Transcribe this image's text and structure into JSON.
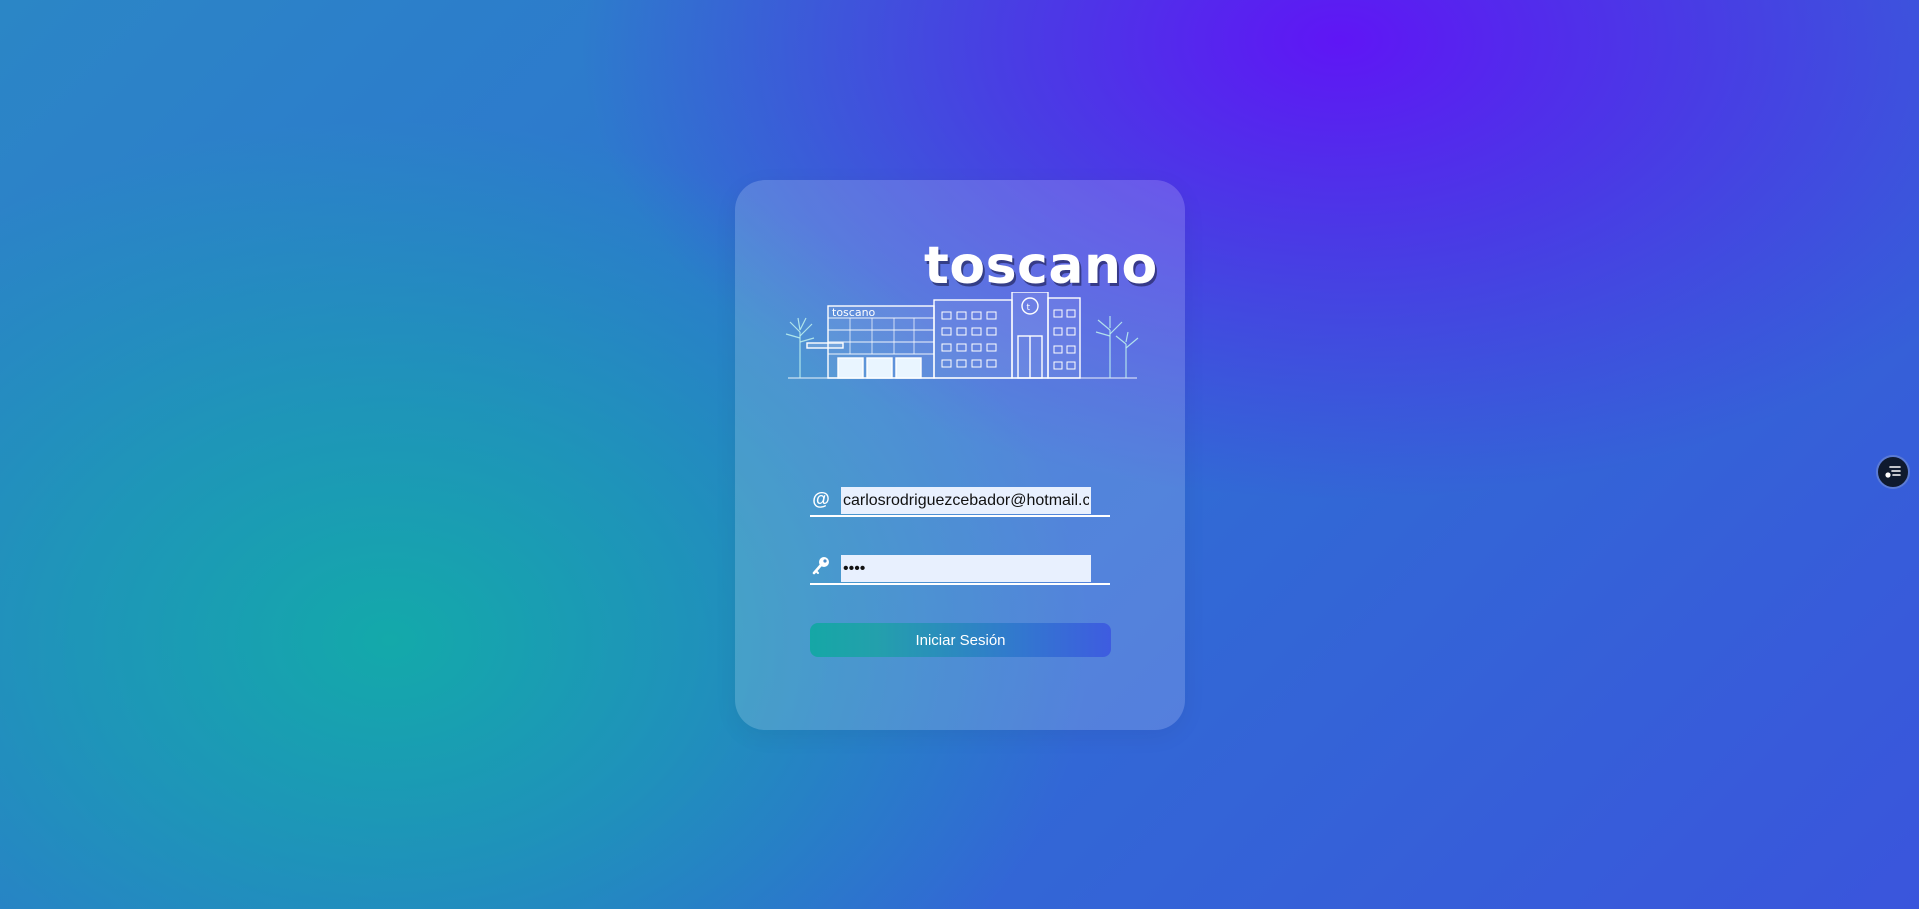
{
  "brand": {
    "name": "toscano",
    "building_sign": "toscano",
    "building_clock_letter": "t"
  },
  "login": {
    "email_value": "carlosrodriguezcebador@hotmail.com",
    "password_value": "1234",
    "submit_label": "Iniciar Sesión"
  },
  "icons": {
    "email": "at-icon",
    "password": "key-icon",
    "floating": "accessibility-menu-icon"
  },
  "colors": {
    "teal": "#15a7a6",
    "violet": "#5f14f6",
    "input_autofill_bg": "#e8f0fe"
  }
}
